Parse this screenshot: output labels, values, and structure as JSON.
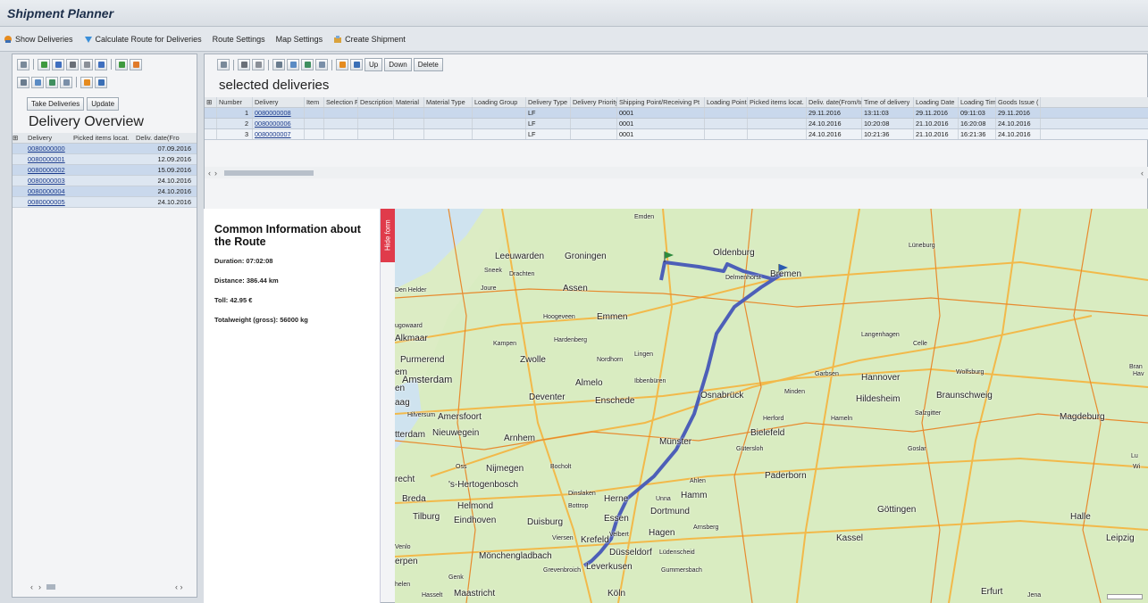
{
  "app": {
    "title": "Shipment Planner"
  },
  "menu": [
    {
      "label": "Show Deliveries",
      "icon": "show-deliveries-icon"
    },
    {
      "label": "Calculate Route for Deliveries",
      "icon": "calculate-route-icon"
    },
    {
      "label": "Route Settings",
      "icon": ""
    },
    {
      "label": "Map Settings",
      "icon": ""
    },
    {
      "label": "Create Shipment",
      "icon": "create-shipment-icon"
    }
  ],
  "left_panel": {
    "take_label": "Take Deliveries",
    "update_label": "Update",
    "title": "Delivery Overview",
    "columns": [
      "Delivery",
      "Picked items locat.",
      "Deliv. date(Fro"
    ],
    "rows": [
      {
        "delivery": "0080000000",
        "date": "07.09.2016"
      },
      {
        "delivery": "0080000001",
        "date": "12.09.2016"
      },
      {
        "delivery": "0080000002",
        "date": "15.09.2016"
      },
      {
        "delivery": "0080000003",
        "date": "24.10.2016"
      },
      {
        "delivery": "0080000004",
        "date": "24.10.2016"
      },
      {
        "delivery": "0080000005",
        "date": "24.10.2016"
      }
    ]
  },
  "right_panel": {
    "up_label": "Up",
    "down_label": "Down",
    "delete_label": "Delete",
    "title": "selected deliveries",
    "columns": [
      "Number",
      "Delivery",
      "Item",
      "Selection Flag",
      "Description",
      "Material",
      "Material Type",
      "Loading Group",
      "Delivery Type",
      "Delivery Priority",
      "Shipping Point/Receiving Pt",
      "Loading Point",
      "Picked items locat.",
      "Deliv. date(From/to)",
      "Time of delivery",
      "Loading Date",
      "Loading Time",
      "Goods Issue ("
    ],
    "rows": [
      {
        "number": "1",
        "delivery": "0080000008",
        "type": "LF",
        "ship": "0001",
        "deldate": "29.11.2016",
        "deltime": "13:11:03",
        "loaddate": "29.11.2016",
        "loadtime": "09:11:03",
        "gi": "29.11.2016"
      },
      {
        "number": "2",
        "delivery": "0080000006",
        "type": "LF",
        "ship": "0001",
        "deldate": "24.10.2016",
        "deltime": "10:20:08",
        "loaddate": "21.10.2016",
        "loadtime": "16:20:08",
        "gi": "24.10.2016"
      },
      {
        "number": "3",
        "delivery": "0080000007",
        "type": "LF",
        "ship": "0001",
        "deldate": "24.10.2016",
        "deltime": "10:21:36",
        "loaddate": "21.10.2016",
        "loadtime": "16:21:36",
        "gi": "24.10.2016"
      }
    ]
  },
  "route_info": {
    "title": "Common Information about the Route",
    "duration": "Duration: 07:02:08",
    "distance": "Distance: 386.44 km",
    "toll": "Toll: 42.95 €",
    "weight": "Totalweight (gross): 56000 kg",
    "hide_label": "Hide form"
  },
  "map": {
    "cities": [
      "Emden",
      "Lüneburg",
      "Leeuwarden",
      "Groningen",
      "Oldenburg",
      "Bremen",
      "Sneek",
      "Drachten",
      "Delmenhorst",
      "Den Helder",
      "Joure",
      "Assen",
      "Hoogeveen",
      "Emmen",
      "Alkmaar",
      "Kampen",
      "Hardenberg",
      "Celle",
      "Langenhagen",
      "Purmerend",
      "Zwolle",
      "Nordhorn",
      "Lingen",
      "Wolfsburg",
      "Garbsen",
      "Hannover",
      "Amsterdam",
      "Almelo",
      "Ibbenbüren",
      "Minden",
      "Osnabrück",
      "Braunschweig",
      "Deventer",
      "Enschede",
      "Hildesheim",
      "Salzgitter",
      "Magdeburg",
      "Hilversum",
      "Amersfoort",
      "Herford",
      "Hameln",
      "Bielefeld",
      "Nieuwegein",
      "Arnhem",
      "Münster",
      "Gütersloh",
      "Goslar",
      "Oss",
      "Nijmegen",
      "Bocholt",
      "Ahlen",
      "Paderborn",
      "'s-Hertogenbosch",
      "Hamm",
      "Dinslaken",
      "Herne",
      "Unna",
      "Breda",
      "Helmond",
      "Bottrop",
      "Dortmund",
      "Tilburg",
      "Eindhoven",
      "Duisburg",
      "Essen",
      "Göttingen",
      "Halle",
      "Velbert",
      "Hagen",
      "Arnsberg",
      "Viersen",
      "Krefeld",
      "Kassel",
      "Leipzig",
      "Venlo",
      "Düsseldorf",
      "Lüdenscheid",
      "Mönchengladbach",
      "Grevenbroich",
      "Leverkusen",
      "Gummersbach",
      "Genk",
      "Hasselt",
      "Maastricht",
      "Köln",
      "Erfurt",
      "Jena",
      "Bran",
      "Hav",
      "Lu",
      "Wi",
      "em",
      "aag",
      "tterdam",
      "recht",
      "ugowaard",
      "erpen",
      "helen",
      "en"
    ],
    "route_color": "#4d5fb8"
  }
}
